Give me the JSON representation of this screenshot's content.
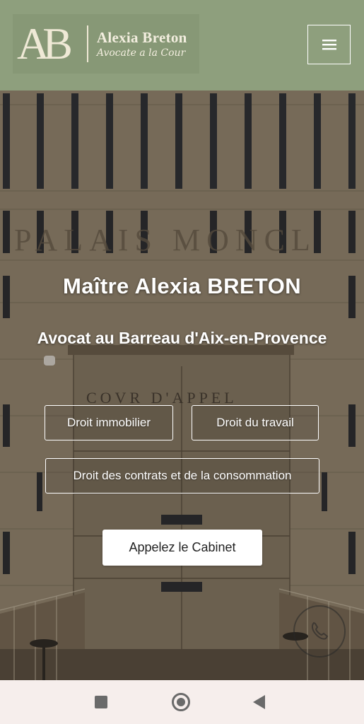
{
  "header": {
    "logo_monogram": "AB",
    "logo_name": "Alexia Breton",
    "logo_tagline": "Avocate a la Cour",
    "background_color": "#8e9f7d",
    "menu_icon": "hamburger-icon"
  },
  "hero": {
    "title": "Maître Alexia BRETON",
    "subtitle": "Avocat au Barreau d'Aix-en-Provence",
    "practice_areas": [
      {
        "label": "Droit immobilier"
      },
      {
        "label": "Droit du travail"
      },
      {
        "label": "Droit des contrats et de la consommation"
      }
    ],
    "cta_label": "Appelez le Cabinet",
    "background_inscriptions": [
      "PALAIS MONCL",
      "COVR D'APPEL"
    ],
    "scroll_icon": "phone-icon"
  },
  "android_nav": {
    "recents_icon": "square-icon",
    "home_icon": "circle-home-icon",
    "back_icon": "triangle-back-icon"
  }
}
